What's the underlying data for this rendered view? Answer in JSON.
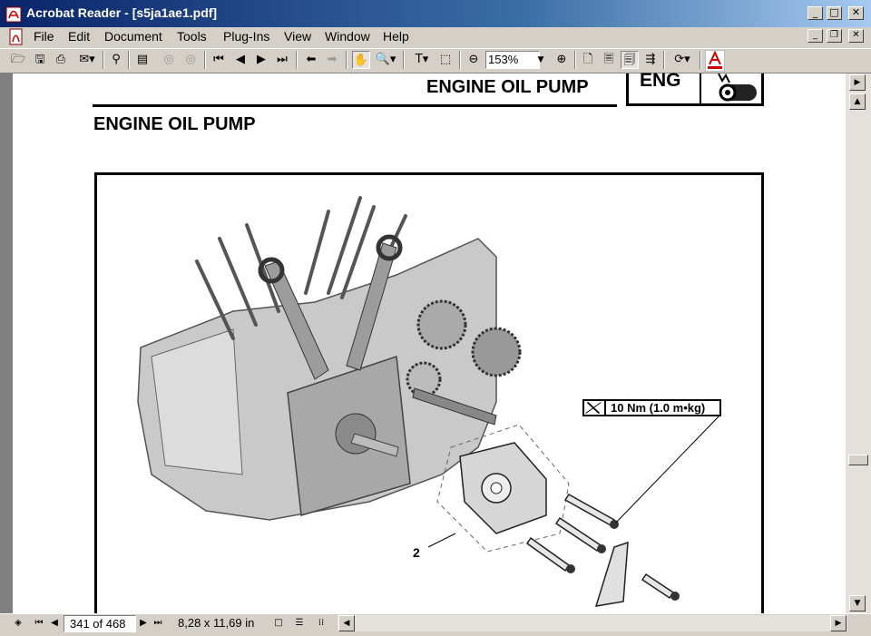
{
  "window": {
    "title": "Acrobat Reader - [s5ja1ae1.pdf]",
    "app_icon": "acrobat-icon",
    "caption_buttons": [
      "minimize-icon",
      "maximize-icon",
      "close-icon"
    ]
  },
  "menu": {
    "items": [
      "File",
      "Edit",
      "Document",
      "Tools",
      "Plug-Ins",
      "View",
      "Window",
      "Help"
    ],
    "doc_buttons": [
      "minimize-icon",
      "restore-icon",
      "close-icon"
    ]
  },
  "toolbar": {
    "icons": [
      "open-icon",
      "save-icon",
      "print-icon",
      "email-icon",
      "find-icon",
      "bookmarks-icon",
      "thumbnail-left-icon",
      "thumbnail-right-icon",
      "first-page-icon",
      "prev-page-icon",
      "next-page-icon",
      "last-page-icon",
      "back-icon",
      "forward-icon",
      "hand-icon",
      "zoom-icon",
      "text-select-icon",
      "graphics-select-icon",
      "zoom-out-icon",
      "zoom-in-icon",
      "actual-size-icon",
      "fit-page-icon",
      "fit-width-icon",
      "reflow-icon",
      "rotate-icon",
      "adobe-logo-icon"
    ],
    "zoom_value": "153%"
  },
  "document": {
    "header_title": "ENGINE OIL PUMP",
    "tab_label": "ENG",
    "section_title": "ENGINE OIL PUMP",
    "torque_spec": "10 Nm (1.0 m•kg)",
    "callout_number": "2"
  },
  "status": {
    "page_indicator": "341 of 468",
    "page_size": "8,28 x 11,69 in"
  },
  "colors": {
    "titlebar_start": "#0a246a",
    "titlebar_end": "#a6caf0",
    "chrome": "#d4d0c8",
    "workspace": "#808080",
    "adobe_red": "#cc0000"
  }
}
